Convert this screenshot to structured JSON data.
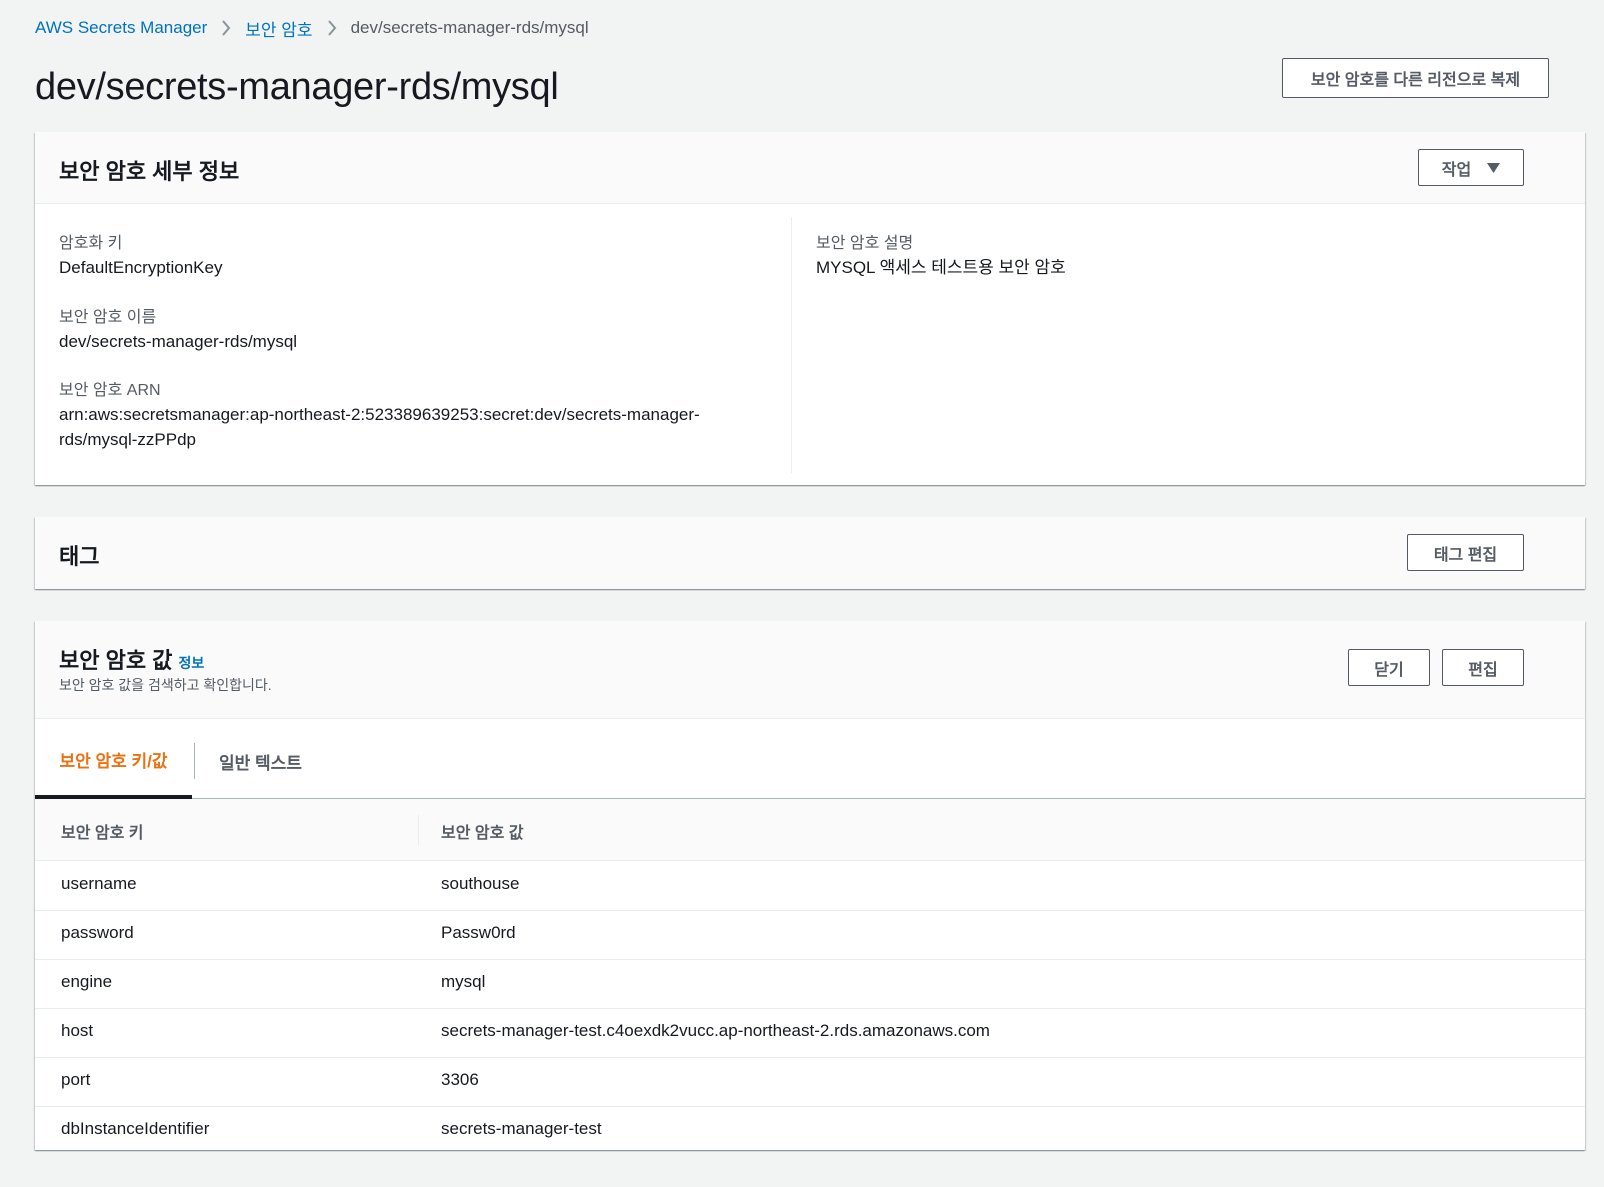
{
  "breadcrumb": {
    "items": [
      "AWS Secrets Manager",
      "보안 암호"
    ],
    "current": "dev/secrets-manager-rds/mysql"
  },
  "page": {
    "title": "dev/secrets-manager-rds/mysql",
    "replicate_button": "보안 암호를 다른 리전으로 복제"
  },
  "details": {
    "title": "보안 암호 세부 정보",
    "actions_button": "작업",
    "fields": [
      {
        "label": "암호화 키",
        "value": "DefaultEncryptionKey"
      },
      {
        "label": "보안 암호 이름",
        "value": "dev/secrets-manager-rds/mysql"
      },
      {
        "label": "보안 암호 ARN",
        "value_line1": "arn:aws:secretsmanager:ap-northeast-2:523389639253:secret:dev/secrets-manager-",
        "value_line2": "rds/mysql-zzPPdp"
      }
    ],
    "description": {
      "label": "보안 암호 설명",
      "value": "MYSQL 액세스 테스트용 보안 암호"
    }
  },
  "tags": {
    "title": "태그",
    "edit_button": "태그 편집"
  },
  "secret_value": {
    "title": "보안 암호 값",
    "info_link": "정보",
    "subtitle": "보안 암호 값을 검색하고 확인합니다.",
    "close_button": "닫기",
    "edit_button": "편집",
    "tabs": [
      "보안 암호 키/값",
      "일반 텍스트"
    ],
    "columns": [
      "보안 암호 키",
      "보안 암호 값"
    ],
    "rows": [
      {
        "key": "username",
        "value": "southouse"
      },
      {
        "key": "password",
        "value": "Passw0rd"
      },
      {
        "key": "engine",
        "value": "mysql"
      },
      {
        "key": "host",
        "value": "secrets-manager-test.c4oexdk2vucc.ap-northeast-2.rds.amazonaws.com"
      },
      {
        "key": "port",
        "value": "3306"
      },
      {
        "key": "dbInstanceIdentifier",
        "value": "secrets-manager-test"
      }
    ]
  },
  "colors": {
    "link": "#0073bb",
    "active_tab": "#ec7211",
    "background": "#f2f3f3"
  }
}
